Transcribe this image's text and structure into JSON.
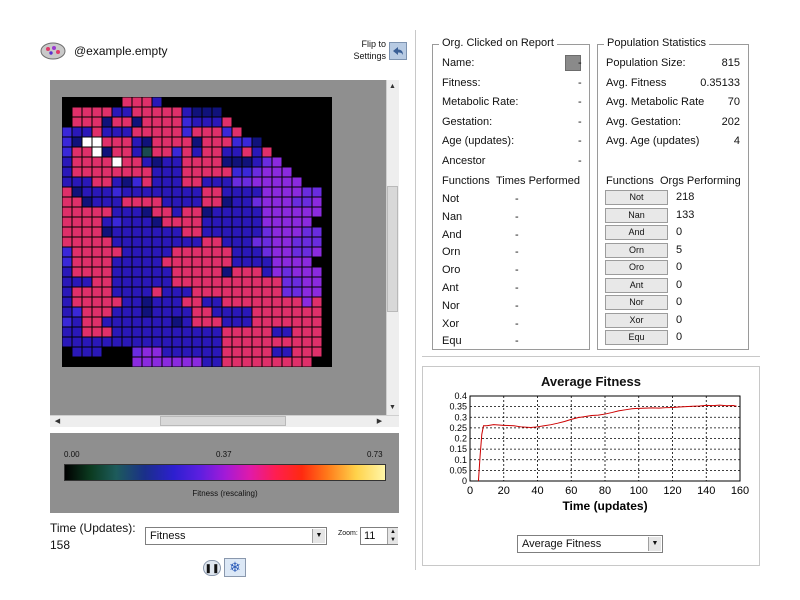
{
  "header": {
    "dish_name": "@example.empty",
    "flip_label": "Flip to Settings"
  },
  "grid": {
    "columns": 27,
    "rows": 27,
    "cell_colors": {
      "0": "#000000",
      "1": "#10127a",
      "2": "#2a18b8",
      "3": "#3a28d8",
      "4": "#6a2ce0",
      "5": "#8b2ae0",
      "6": "#e0306a",
      "7": "#d02858",
      "8": "#1a4a50",
      "9": "#ffffff"
    },
    "cells": [
      "000000666200000000000000000",
      "066662266666211100000000000",
      "066616616666322260000000000",
      "322622266666366636000000000",
      "319966621666616663310000000",
      "366916628663626622626000000",
      "266669662122666611124500000",
      "266666666222666663345550000",
      "222662136222662224455555000",
      "612223222222226622225555440",
      "661222666622226612245554450",
      "666662221662661222225555550",
      "666623222166662222225555500",
      "666612222222662222224555440",
      "666662222222226622244554440",
      "366666222226666662224554450",
      "366662222266666662222555500",
      "266662222226666616662545550",
      "222662222226666666666644550",
      "266662222622266666666644550",
      "266666221222662266666666560",
      "236662221222266222266666660",
      "326622222221266622266666660",
      "226662222222222266666226660",
      "222222222222222266666666660",
      "022200045522222266666226660",
      "000000055555552266666666600"
    ]
  },
  "legend": {
    "min": "0.00",
    "mid": "0.37",
    "max": "0.73",
    "caption": "Fitness (rescaling)"
  },
  "controls": {
    "time_label": "Time (Updates):",
    "time_value": "158",
    "mode_value": "Fitness",
    "zoom_label": "Zoom:",
    "zoom_value": "11"
  },
  "org_report": {
    "title": "Org. Clicked on Report",
    "rows": [
      {
        "label": "Name:",
        "value": "-"
      },
      {
        "label": "Fitness:",
        "value": "-"
      },
      {
        "label": "Metabolic Rate:",
        "value": "-"
      },
      {
        "label": "Gestation:",
        "value": "-"
      },
      {
        "label": "Age (updates):",
        "value": "-"
      },
      {
        "label": "Ancestor",
        "value": "-"
      }
    ],
    "functions_header": "Functions",
    "times_header": "Times Performed",
    "functions": [
      {
        "name": "Not",
        "value": "-"
      },
      {
        "name": "Nan",
        "value": "-"
      },
      {
        "name": "And",
        "value": "-"
      },
      {
        "name": "Orn",
        "value": "-"
      },
      {
        "name": "Oro",
        "value": "-"
      },
      {
        "name": "Ant",
        "value": "-"
      },
      {
        "name": "Nor",
        "value": "-"
      },
      {
        "name": "Xor",
        "value": "-"
      },
      {
        "name": "Equ",
        "value": "-"
      }
    ]
  },
  "pop_stats": {
    "title": "Population Statistics",
    "rows": [
      {
        "label": "Population Size:",
        "value": "815"
      },
      {
        "label": "Avg. Fitness",
        "value": "0.35133"
      },
      {
        "label": "Avg. Metabolic Rate",
        "value": "70"
      },
      {
        "label": "Avg. Gestation:",
        "value": "202"
      },
      {
        "label": "Avg. Age (updates)",
        "value": "4"
      }
    ],
    "functions_header": "Functions",
    "orgs_header": "Orgs Performing",
    "functions": [
      {
        "name": "Not",
        "value": "218"
      },
      {
        "name": "Nan",
        "value": "133"
      },
      {
        "name": "And",
        "value": "0"
      },
      {
        "name": "Orn",
        "value": "5"
      },
      {
        "name": "Oro",
        "value": "0"
      },
      {
        "name": "Ant",
        "value": "0"
      },
      {
        "name": "Nor",
        "value": "0"
      },
      {
        "name": "Xor",
        "value": "0"
      },
      {
        "name": "Equ",
        "value": "0"
      }
    ]
  },
  "chart_data": {
    "type": "line",
    "title": "Average Fitness",
    "xlabel": "Time (updates)",
    "ylabel": "",
    "xlim": [
      0,
      160
    ],
    "ylim": [
      0,
      0.4
    ],
    "x_ticks": [
      "0",
      "20",
      "40",
      "60",
      "80",
      "100",
      "120",
      "140",
      "160"
    ],
    "y_ticks": [
      "0",
      "0.05",
      "0.1",
      "0.15",
      "0.2",
      "0.25",
      "0.3",
      "0.35",
      "0.4"
    ],
    "series": [
      {
        "color": "#cc0000",
        "x": [
          5,
          6,
          7,
          8,
          10,
          14,
          20,
          26,
          30,
          36,
          40,
          44,
          48,
          52,
          56,
          60,
          64,
          68,
          72,
          76,
          80,
          84,
          88,
          92,
          96,
          100,
          104,
          108,
          112,
          116,
          120,
          124,
          128,
          132,
          136,
          140,
          144,
          148,
          152,
          156,
          158
        ],
        "y": [
          0,
          0.12,
          0.22,
          0.26,
          0.26,
          0.265,
          0.262,
          0.26,
          0.255,
          0.252,
          0.255,
          0.26,
          0.265,
          0.272,
          0.28,
          0.29,
          0.298,
          0.303,
          0.308,
          0.31,
          0.315,
          0.322,
          0.33,
          0.335,
          0.34,
          0.342,
          0.343,
          0.344,
          0.343,
          0.345,
          0.346,
          0.348,
          0.35,
          0.352,
          0.353,
          0.356,
          0.355,
          0.357,
          0.354,
          0.355,
          0.352
        ]
      }
    ],
    "grid": true,
    "dropdown_value": "Average Fitness"
  }
}
